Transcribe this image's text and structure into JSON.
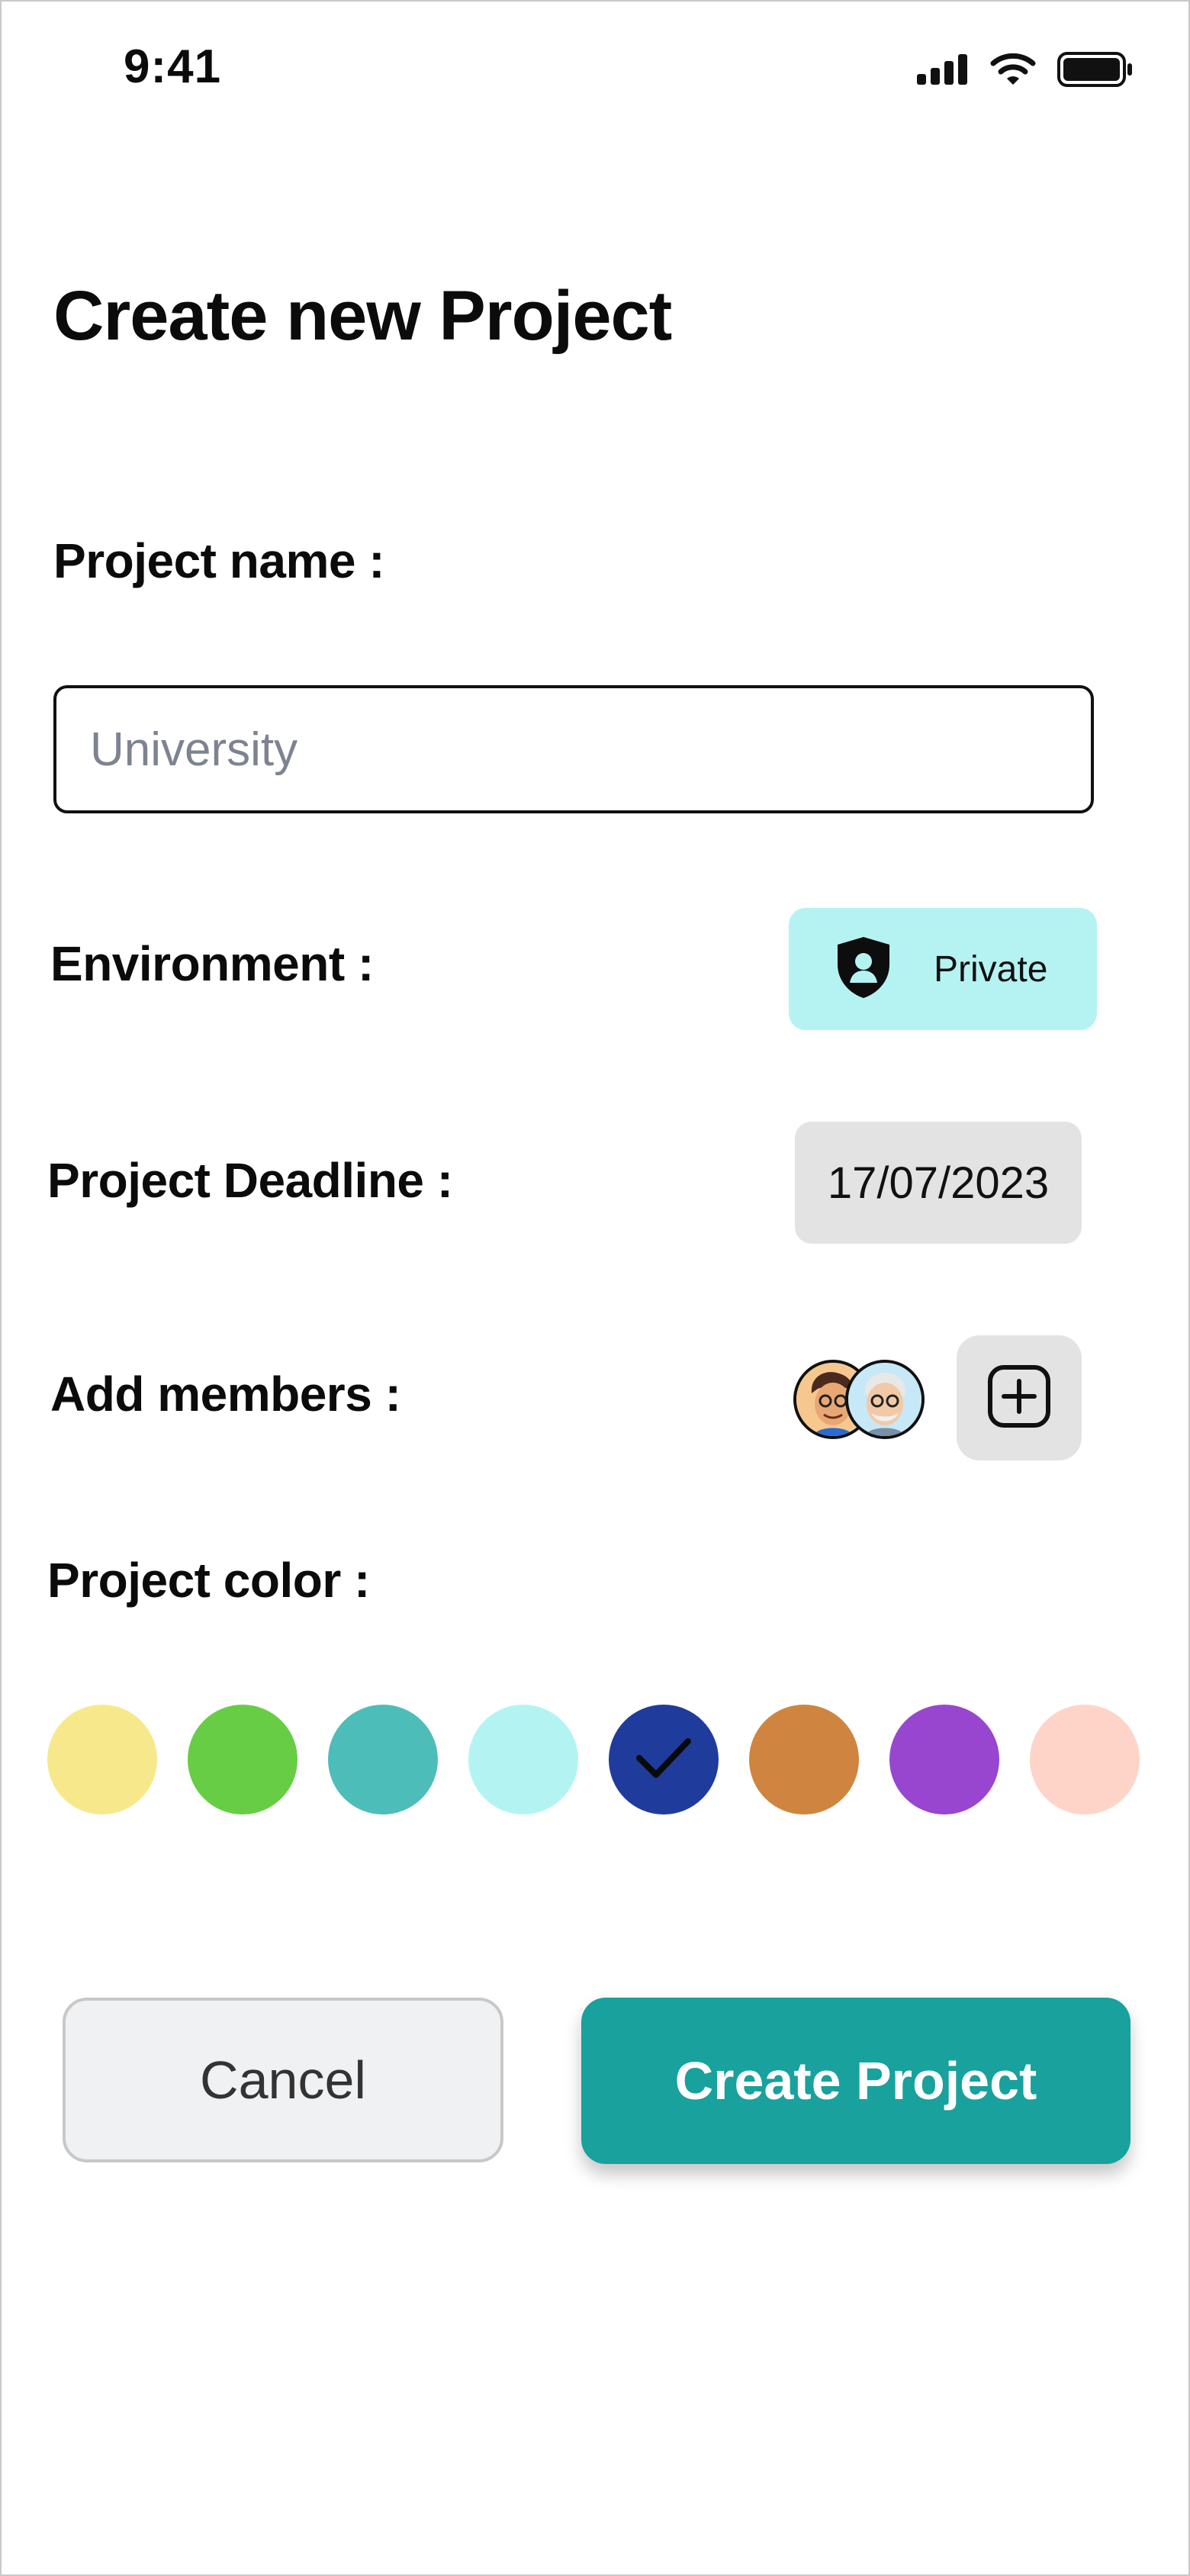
{
  "status_bar": {
    "time": "9:41",
    "icons": [
      "cellular-signal-icon",
      "wifi-icon",
      "battery-icon"
    ]
  },
  "page": {
    "title": "Create new Project"
  },
  "project_name": {
    "label": "Project name :",
    "placeholder": "University"
  },
  "environment": {
    "label": "Environment :",
    "value": "Private",
    "icon": "shield-user-icon"
  },
  "deadline": {
    "label": "Project Deadline :",
    "value": "17/07/2023"
  },
  "members": {
    "label": "Add members :",
    "avatars": [
      "member-avatar-1",
      "member-avatar-2"
    ],
    "add_icon": "plus-square-icon"
  },
  "project_color": {
    "label": "Project color :",
    "swatches": [
      "#f7e98b",
      "#67cd45",
      "#4dbdba",
      "#b3f4f3",
      "#1f3c9c",
      "#cf853f",
      "#9845cf",
      "#ffd4c8"
    ],
    "selected_index": 4
  },
  "actions": {
    "cancel": "Cancel",
    "create": "Create Project"
  },
  "colors": {
    "accent": "#18a19d",
    "env_bg": "#b5f3f2",
    "chip_bg": "#e3e3e3"
  }
}
